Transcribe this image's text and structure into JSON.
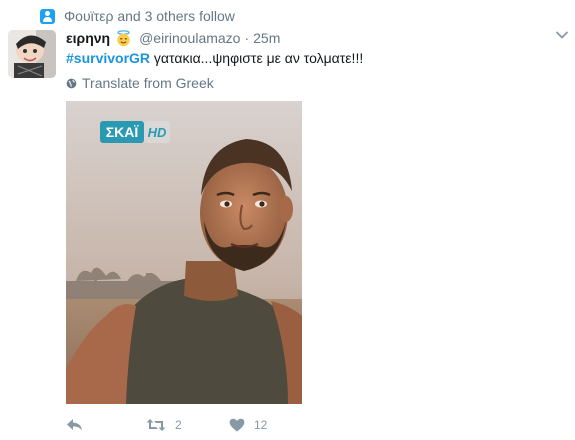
{
  "context": {
    "text": "Φουϊτερ and 3 others follow",
    "icon": "person-icon"
  },
  "tweet": {
    "author_name": "ειρηνη",
    "handle": "@eirinoulamazo",
    "separator": "·",
    "time": "25m",
    "hashtag": "#survivorGR",
    "text": " γατακια...ψηφιστε με αν τολματε!!!",
    "translate_label": "Translate from Greek"
  },
  "media": {
    "channel_logo": "ΣΚΑΪ",
    "channel_logo_suffix": "HD"
  },
  "actions": {
    "reply_icon": "reply-icon",
    "retweet_count": "2",
    "like_count": "12"
  },
  "colors": {
    "link": "#1b95e0",
    "muted": "#657786",
    "icon": "#8899a6",
    "accent": "#1da1f2"
  }
}
